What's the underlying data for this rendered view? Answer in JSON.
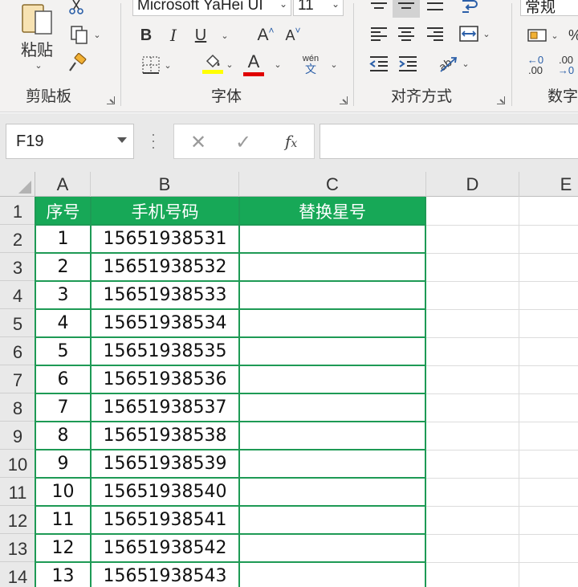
{
  "ribbon": {
    "clipboard": {
      "paste_label": "粘贴",
      "group_label": "剪贴板"
    },
    "font": {
      "font_name": "Microsoft YaHei UI",
      "font_size": "11",
      "bold": "B",
      "italic": "I",
      "underline": "U",
      "grow": "A",
      "shrink": "A",
      "font_color": "A",
      "phonetic_top": "wén",
      "phonetic_bottom": "文",
      "highlight_color": "#ffff00",
      "font_color_hex": "#e00000",
      "group_label": "字体"
    },
    "alignment": {
      "group_label": "对齐方式"
    },
    "number": {
      "format": "常规",
      "dec_increase_top": "←0",
      "dec_increase_bottom": ".00",
      "dec_decrease_top": ".00",
      "dec_decrease_bottom": "→0",
      "group_label": "数字"
    }
  },
  "formula_bar": {
    "name_box": "F19",
    "cancel": "✕",
    "enter": "✓",
    "fx": "fx",
    "formula": ""
  },
  "sheet": {
    "columns": [
      "A",
      "B",
      "C",
      "D",
      "E"
    ],
    "rows": [
      "1",
      "2",
      "3",
      "4",
      "5",
      "6",
      "7",
      "8",
      "9",
      "10",
      "11",
      "12",
      "13",
      "14"
    ],
    "header": [
      "序号",
      "手机号码",
      "替换星号"
    ],
    "data": [
      [
        "1",
        "15651938531",
        ""
      ],
      [
        "2",
        "15651938532",
        ""
      ],
      [
        "3",
        "15651938533",
        ""
      ],
      [
        "4",
        "15651938534",
        ""
      ],
      [
        "5",
        "15651938535",
        ""
      ],
      [
        "6",
        "15651938536",
        ""
      ],
      [
        "7",
        "15651938537",
        ""
      ],
      [
        "8",
        "15651938538",
        ""
      ],
      [
        "9",
        "15651938539",
        ""
      ],
      [
        "10",
        "15651938540",
        ""
      ],
      [
        "11",
        "15651938541",
        ""
      ],
      [
        "12",
        "15651938542",
        ""
      ],
      [
        "13",
        "15651938543",
        ""
      ]
    ],
    "header_fill": "#17a857",
    "table_border": "#1e9a55"
  }
}
